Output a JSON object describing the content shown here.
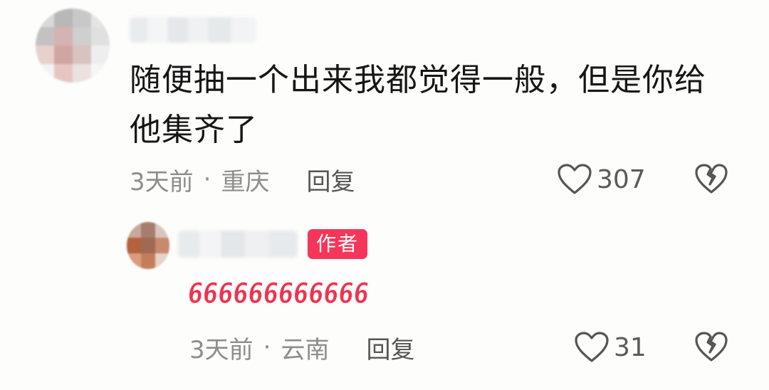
{
  "comment": {
    "text": "随便抽一个出来我都觉得一般，但是你给他集齐了",
    "time": "3天前",
    "separator": "·",
    "location": "重庆",
    "reply_label": "回复",
    "like_count": "307"
  },
  "reply": {
    "author_badge": "作者",
    "stickers_text": "666666666666",
    "time": "3天前",
    "separator": "·",
    "location": "云南",
    "reply_label": "回复",
    "like_count": "31"
  },
  "colors": {
    "badge": "#f4365a",
    "sticker_red": "#ee3350",
    "meta_gray": "#8d8d8d",
    "icon_gray": "#555555"
  },
  "icons": {
    "like": "heart-outline-icon",
    "dislike": "broken-heart-icon"
  }
}
